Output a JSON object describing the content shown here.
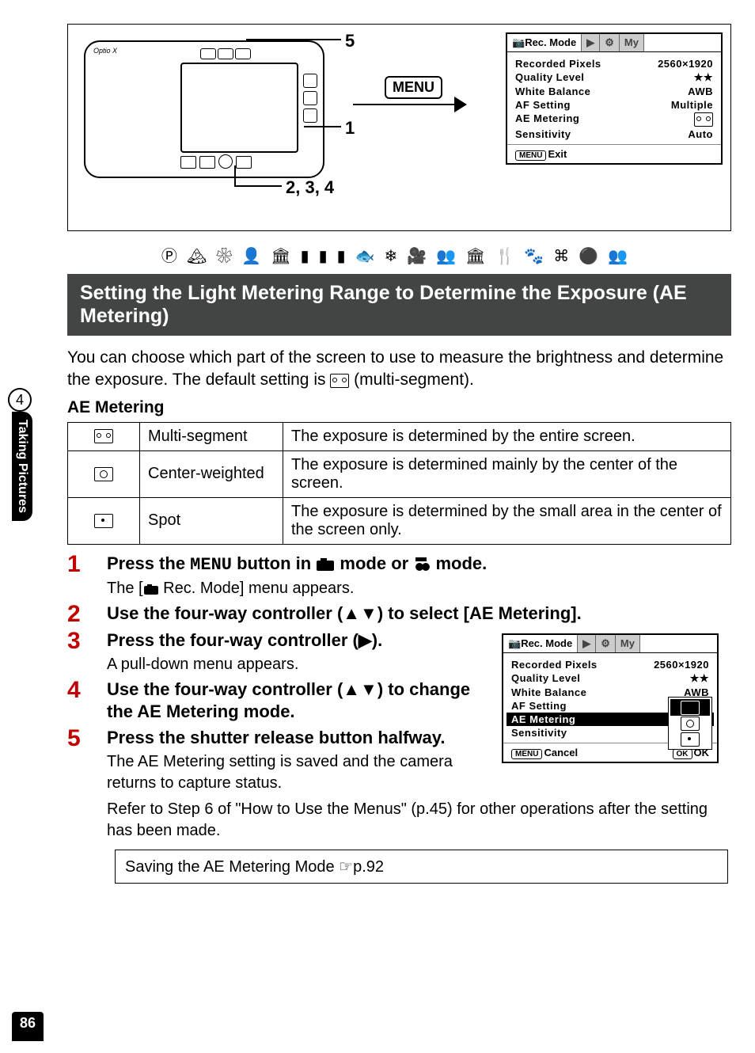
{
  "callouts": {
    "c1": "1",
    "c2": "2, 3, 4",
    "c5": "5"
  },
  "buttons": {
    "menu": "MENU"
  },
  "lcd1": {
    "tab_active": "Rec. Mode",
    "tab_my": "My",
    "rows": {
      "recorded_pixels": {
        "label": "Recorded Pixels",
        "value": "2560×1920"
      },
      "quality_level": {
        "label": "Quality Level",
        "value": "★★"
      },
      "white_balance": {
        "label": "White Balance",
        "value": "AWB"
      },
      "af_setting": {
        "label": "AF Setting",
        "value": "Multiple"
      },
      "ae_metering": {
        "label": "AE Metering",
        "value": ""
      },
      "sensitivity": {
        "label": "Sensitivity",
        "value": "Auto"
      }
    },
    "footer": "Exit"
  },
  "icon_row": "R q < I \\ = H z E D Y G < O",
  "heading": "Setting the Light Metering Range to Determine the Exposure (AE Metering)",
  "side_label": "Taking Pictures",
  "section_num": "4",
  "intro": {
    "p1a": "You can choose which part of the screen to use to measure the brightness and determine the exposure. The default setting is ",
    "p1b": " (multi-segment)."
  },
  "ae_heading": "AE Metering",
  "ae_table": {
    "r1": {
      "name": "Multi-segment",
      "desc": "The exposure is determined by the entire screen."
    },
    "r2": {
      "name": "Center-weighted",
      "desc": "The exposure is determined mainly by the center of the screen."
    },
    "r3": {
      "name": "Spot",
      "desc": "The exposure is determined by the small area in the center of the screen only."
    }
  },
  "steps": {
    "s1": {
      "num": "1",
      "title_a": "Press the ",
      "title_btn": "MENU",
      "title_b": " button in ",
      "title_c": " mode or ",
      "title_d": " mode.",
      "text": "The [A Rec. Mode] menu appears."
    },
    "s2": {
      "num": "2",
      "title": "Use the four-way controller (▲▼) to select [AE Metering]."
    },
    "s3": {
      "num": "3",
      "title": "Press the four-way controller (▶).",
      "text": "A pull-down menu appears."
    },
    "s4": {
      "num": "4",
      "title": "Use the four-way controller (▲▼) to change the AE Metering mode."
    },
    "s5": {
      "num": "5",
      "title": "Press the shutter release button halfway.",
      "text1": "The AE Metering setting is saved and the camera returns to capture status.",
      "text2": "Refer to Step 6 of \"How to Use the Menus\" (p.45) for other operations after the setting has been made."
    }
  },
  "lcd2": {
    "tab_active": "Rec. Mode",
    "tab_my": "My",
    "rows": {
      "recorded_pixels": {
        "label": "Recorded Pixels",
        "value": "2560×1920"
      },
      "quality_level": {
        "label": "Quality Level",
        "value": "★★"
      },
      "white_balance": {
        "label": "White Balance",
        "value": "AWB"
      },
      "af_setting": {
        "label": "AF Setting"
      },
      "ae_metering": {
        "label": "AE Metering"
      },
      "sensitivity": {
        "label": "Sensitivity"
      }
    },
    "footer_left": "Cancel",
    "footer_right": "OK",
    "footer_ok_label": "OK"
  },
  "ref_box": "Saving the AE Metering Mode ☞p.92",
  "page_number": "86"
}
